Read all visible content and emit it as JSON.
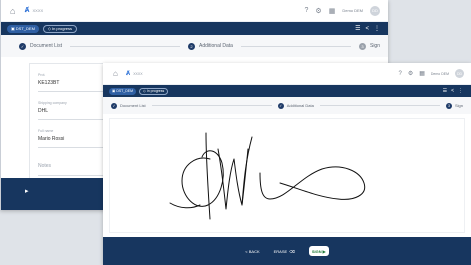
{
  "back": {
    "logo_text": "XXXX",
    "user": "Demo DEM",
    "doc_pill": "DST_DEM",
    "status_pill": "In progress",
    "steps": [
      "Document List",
      "Additional Data",
      "Sign"
    ],
    "fields": [
      {
        "label": "Prot.",
        "value": "KE123BT"
      },
      {
        "label": "Shipping company",
        "value": "DHL"
      },
      {
        "label": "Full name",
        "value": "Mario Rossi"
      },
      {
        "label": "Notes",
        "value": ""
      }
    ]
  },
  "front": {
    "logo_text": "XXXX",
    "user": "Demo DEM",
    "doc_pill": "DST_DEM",
    "status_pill": "In progress",
    "steps": [
      "Document List",
      "Additional Data",
      "Sign"
    ],
    "back_label": "< BACK",
    "erase_label": "ERASE",
    "sign_label": "SIGN"
  },
  "colors": {
    "navy": "#17365f",
    "accent": "#2f5fa3",
    "sign_green": "#1f7a3a"
  }
}
